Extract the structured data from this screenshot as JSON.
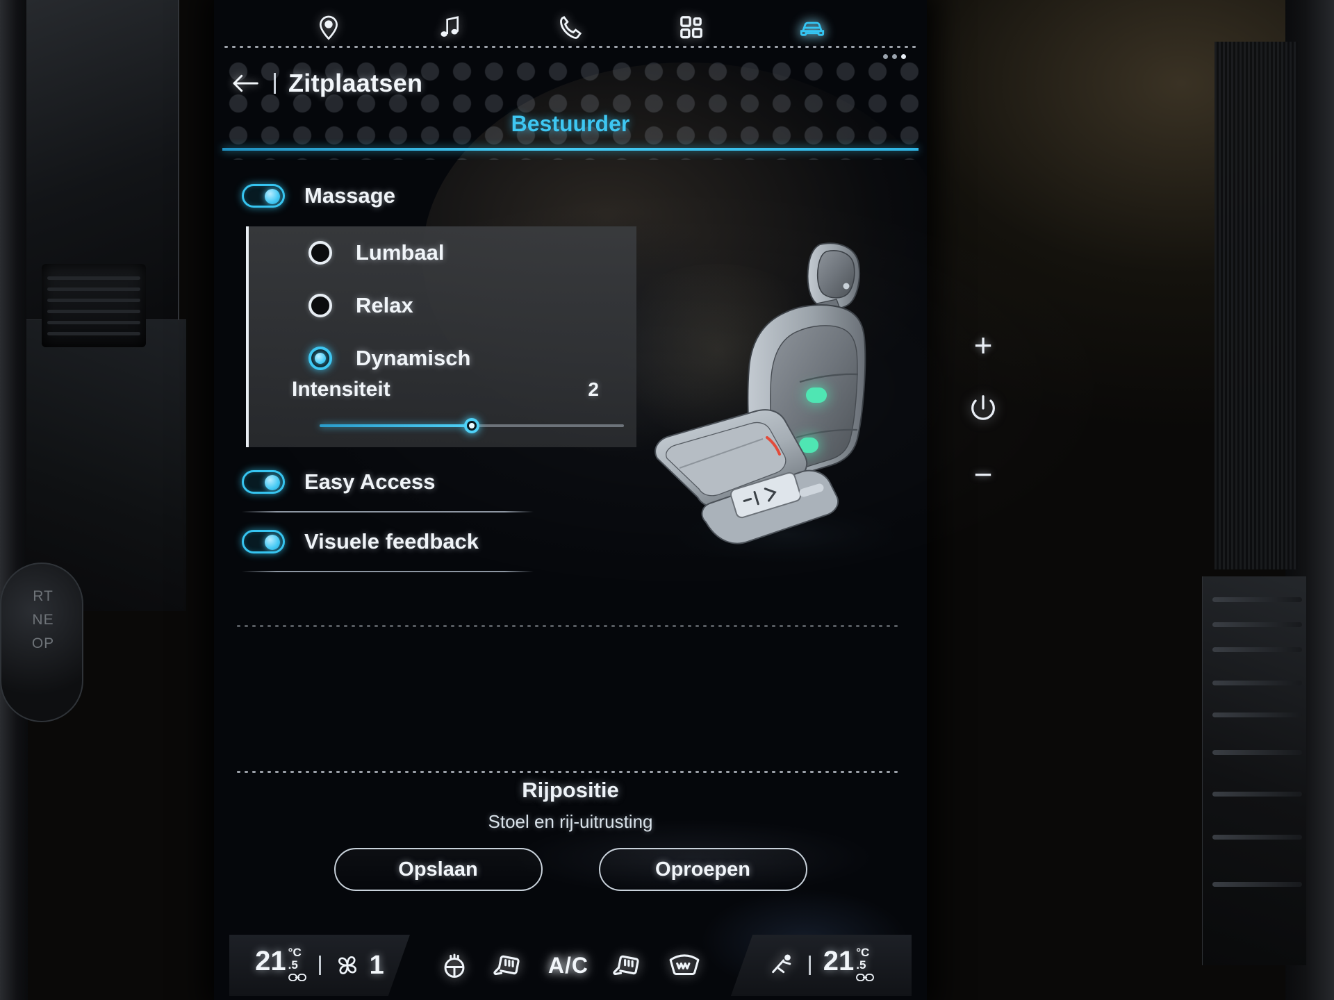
{
  "topbar": {
    "icons": [
      {
        "name": "navigation-pin-icon",
        "label": "Navigatie",
        "active": false
      },
      {
        "name": "music-note-icon",
        "label": "Media",
        "active": false
      },
      {
        "name": "phone-icon",
        "label": "Telefoon",
        "active": false
      },
      {
        "name": "apps-grid-icon",
        "label": "Apps",
        "active": false
      },
      {
        "name": "car-icon",
        "label": "Voertuig",
        "active": true
      }
    ],
    "page_dots": 3
  },
  "header": {
    "back_label": "←",
    "title": "Zitplaatsen"
  },
  "tab": {
    "label": "Bestuurder"
  },
  "settings": {
    "massage": {
      "label": "Massage",
      "toggle_state": "on",
      "options": [
        {
          "label": "Lumbaal",
          "selected": false
        },
        {
          "label": "Relax",
          "selected": false
        },
        {
          "label": "Dynamisch",
          "selected": true
        }
      ],
      "intensity": {
        "label": "Intensiteit",
        "value": "2",
        "min": 1,
        "max": 3,
        "percent": 50
      }
    },
    "easy_access": {
      "label": "Easy Access",
      "toggle_state": "on"
    },
    "visual_feedback": {
      "label": "Visuele feedback",
      "toggle_state": "on"
    }
  },
  "driving_position": {
    "title": "Rijpositie",
    "subtitle": "Stoel en rij-uitrusting",
    "save_label": "Opslaan",
    "recall_label": "Oproepen"
  },
  "climate": {
    "left_temp": {
      "value": "21",
      "decimal": ".5",
      "unit": "°C",
      "sync_icon": "link-icon"
    },
    "fan": {
      "icon": "fan-icon",
      "speed": "1"
    },
    "right_temp": {
      "value": "21",
      "decimal": ".5",
      "unit": "°C",
      "sync_icon": "link-icon"
    },
    "icons": [
      {
        "name": "steering-wheel-heat-icon",
        "label": "Stuurverwarming"
      },
      {
        "name": "seat-heat-left-icon",
        "label": "Stoelverwarming links"
      },
      {
        "name": "ac-label",
        "label": "A/C"
      },
      {
        "name": "seat-heat-right-icon",
        "label": "Stoelverwarming rechts"
      },
      {
        "name": "rear-defrost-icon",
        "label": "Achterruitverwarming"
      },
      {
        "name": "airflow-icon",
        "label": "Luchtstroom"
      }
    ]
  },
  "hardware": {
    "volume_up": "+",
    "power": "power-icon",
    "volume_down": "−"
  },
  "colors": {
    "accent": "#3ec7f2",
    "screen_bg": "#05070b",
    "panel_bg": "#3a3c3f",
    "text": "#f0f4f8"
  },
  "dash_labels": {
    "start_stop": [
      "RT",
      "NE",
      "OP"
    ]
  }
}
